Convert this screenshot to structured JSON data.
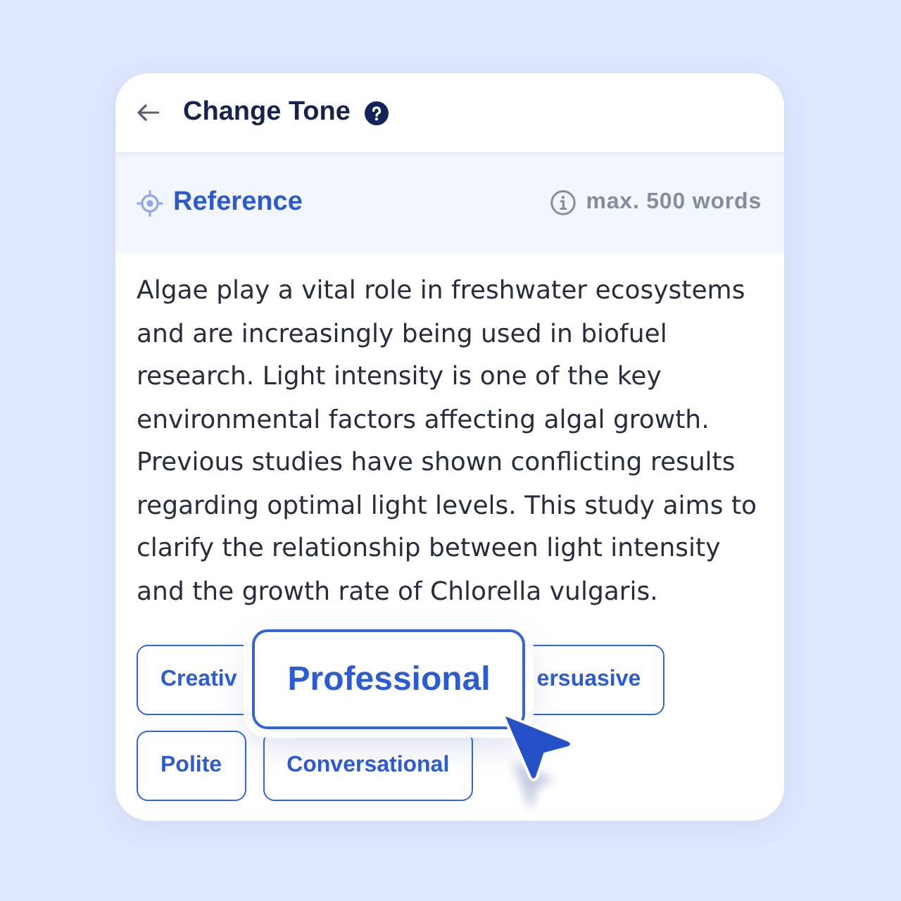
{
  "header": {
    "title": "Change Tone"
  },
  "reference": {
    "label": "Reference",
    "limit": "max. 500 words"
  },
  "text": "Algae play a vital role in freshwater ecosystems and are increasingly being used in biofuel research. Light intensity is one of the key environmental factors affecting algal growth. Previous studies have shown conflicting results regarding optimal light levels. This study aims to clarify the relationship between light intensity and the growth rate of Chlorella vulgaris.",
  "tone_rows": [
    {
      "tones": [
        {
          "label": "Creativ",
          "selected": false
        },
        {
          "label": "Professional",
          "selected": true
        },
        {
          "label": "ersuasive",
          "selected": false
        }
      ]
    },
    {
      "tones": [
        {
          "label": "Polite",
          "selected": false
        },
        {
          "label": "Conversational",
          "selected": false
        }
      ]
    }
  ]
}
